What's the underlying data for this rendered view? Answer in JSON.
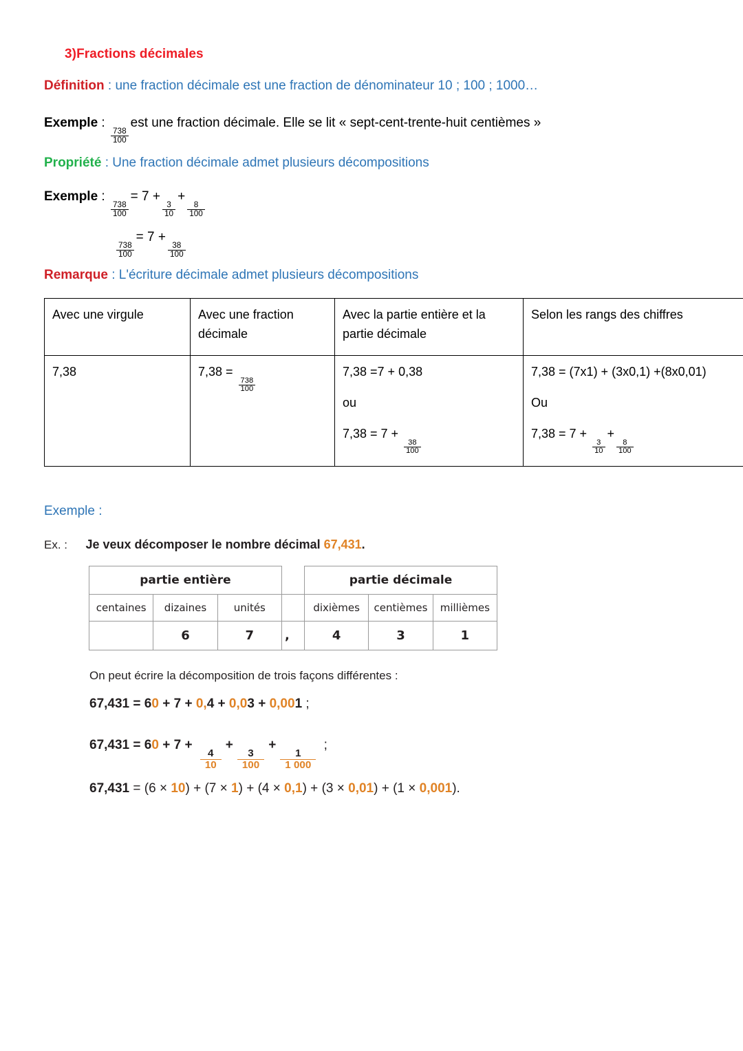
{
  "document": {
    "section_title": "3)Fractions décimales",
    "definition": {
      "keyword": "Définition",
      "separator": " : ",
      "text": "une fraction décimale est une fraction de dénominateur 10 ; 100 ; 1000…"
    },
    "example1": {
      "keyword": "Exemple",
      "separator": " : ",
      "fraction_num": "738",
      "fraction_den": "100",
      "text": "est une fraction décimale. Elle se lit « sept-cent-trente-huit centièmes »"
    },
    "property": {
      "keyword": "Propriété",
      "separator": " : ",
      "text": "Une fraction décimale admet plusieurs décompositions"
    },
    "example2": {
      "keyword": "Exemple",
      "separator": " : ",
      "line1": {
        "lhs_num": "738",
        "lhs_den": "100",
        "eq": "=",
        "whole": "7",
        "plus1": "+",
        "f1_num": "3",
        "f1_den": "10",
        "plus2": "+",
        "f2_num": "8",
        "f2_den": "100"
      },
      "line2": {
        "lhs_num": "738",
        "lhs_den": "100",
        "eq": "=",
        "whole": "7",
        "plus1": "+",
        "f1_num": "38",
        "f1_den": "100"
      }
    },
    "remark": {
      "keyword": "Remarque",
      "separator": " : ",
      "text": "L'écriture décimale admet plusieurs décompositions"
    },
    "decomposition_table": {
      "headers": [
        "Avec une virgule",
        "Avec une fraction décimale",
        "Avec la partie entière et la partie décimale",
        "Selon les rangs des chiffres"
      ],
      "row": {
        "col1": "7,38",
        "col2": {
          "prefix": "7,38 = ",
          "num": "738",
          "den": "100"
        },
        "col3": {
          "first": "7,38 =7 + 0,38",
          "connector": "ou",
          "second_prefix": "7,38 = 7 + ",
          "second_num": "38",
          "second_den": "100"
        },
        "col4": {
          "first": "7,38 = (7x1) + (3x0,1) +(8x0,01)",
          "connector": "Ou",
          "second_prefix": "7,38 = 7 + ",
          "f1_num": "3",
          "f1_den": "10",
          "plus": "+",
          "f2_num": "8",
          "f2_den": "100"
        }
      }
    },
    "example3_label": "Exemple :",
    "ex_block": {
      "tag": "Ex. :",
      "sentence_prefix": "Je veux décomposer le nombre décimal ",
      "number": "67,431",
      "sentence_suffix": "."
    },
    "place_value_table": {
      "group_integer": "partie entière",
      "group_decimal": "partie décimale",
      "ranks": [
        "centaines",
        "dizaines",
        "unités",
        "dixièmes",
        "centièmes",
        "millièmes"
      ],
      "separator": ",",
      "values": [
        "",
        "6",
        "7",
        "4",
        "3",
        "1"
      ]
    },
    "decompositions": {
      "intro": "On peut écrire la décomposition de trois façons différentes :",
      "line1": {
        "number": "67,431",
        "eq": " = ",
        "t1_black": "6",
        "t1_orange": "0",
        "p1": " + ",
        "t2_black": "7",
        "p2": " + ",
        "t3_orange": "0,",
        "t3_black": "4",
        "p3": " + ",
        "t4_orange": "0,0",
        "t4_black": "3",
        "p4": " + ",
        "t5_orange": "0,00",
        "t5_black": "1",
        "end": " ;"
      },
      "line2": {
        "number": "67,431",
        "eq": " = ",
        "t1_black": "6",
        "t1_orange": "0",
        "p1": " + ",
        "t2_black": "7",
        "p2": " + ",
        "f1_num": "4",
        "f1_den": "10",
        "p3": "+",
        "f2_num": "3",
        "f2_den": "100",
        "p4": "+",
        "f3_num": "1",
        "f3_den": "1 000",
        "end": " ;"
      },
      "line3": {
        "number": "67,431",
        "eq": " = ",
        "g1_open": "(6 × ",
        "g1_orange": "10",
        "g1_close": ")",
        "p1": " + ",
        "g2_open": "(7 × ",
        "g2_orange": "1",
        "g2_close": ")",
        "p2": " + ",
        "g3_open": "(4 × ",
        "g3_orange": "0,1",
        "g3_close": ")",
        "p3": " + ",
        "g4_open": "(3 × ",
        "g4_orange": "0,01",
        "g4_close": ")",
        "p4": " + ",
        "g5_open": "(1 × ",
        "g5_orange": "0,001",
        "g5_close": ")",
        "end": "."
      }
    }
  },
  "colors": {
    "title_red": "#ee1c25",
    "keyword_red": "#cf2027",
    "keyword_green": "#22b14c",
    "body_blue": "#2e75b6",
    "accent_orange": "#e08326",
    "text_black": "#231f20"
  }
}
